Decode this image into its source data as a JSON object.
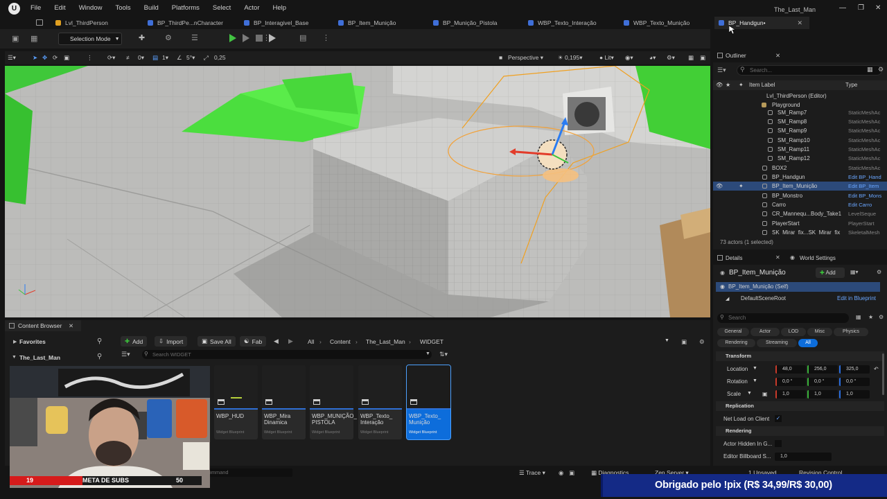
{
  "menu": {
    "items": [
      "File",
      "Edit",
      "Window",
      "Tools",
      "Build",
      "Platforms",
      "Select",
      "Actor",
      "Help"
    ],
    "project_name": "The_Last_Man"
  },
  "tabs": [
    {
      "label": "Lvl_ThirdPerson",
      "active": false
    },
    {
      "label": "BP_ThirdPe...nCharacter",
      "active": false
    },
    {
      "label": "BP_Interagivel_Base",
      "active": false
    },
    {
      "label": "BP_Item_Munição",
      "active": false
    },
    {
      "label": "BP_Munição_Pistola",
      "active": false
    },
    {
      "label": "WBP_Texto_Interação",
      "active": false
    },
    {
      "label": "WBP_Texto_Munição",
      "active": false
    },
    {
      "label": "BP_Handgun•",
      "active": true
    }
  ],
  "toolbar": {
    "selection_mode": "Selection Mode"
  },
  "viewport": {
    "grid_value": "0",
    "rot_value": "1",
    "snap_angle": "5°",
    "scale_snap": "0,25",
    "perspective": "Perspective",
    "speed": "0,195",
    "lit": "Lit"
  },
  "outliner": {
    "title": "Outliner",
    "search_placeholder": "Search...",
    "col_label": "Item Label",
    "col_type": "Type",
    "rows": [
      {
        "label": "Lvl_ThirdPerson (Editor)",
        "type": ""
      },
      {
        "label": "Playground",
        "type": ""
      },
      {
        "label": "SM_Ramp7",
        "type": "StaticMeshAc"
      },
      {
        "label": "SM_Ramp8",
        "type": "StaticMeshAc"
      },
      {
        "label": "SM_Ramp9",
        "type": "StaticMeshAc"
      },
      {
        "label": "SM_Ramp10",
        "type": "StaticMeshAc"
      },
      {
        "label": "SM_Ramp11",
        "type": "StaticMeshAc"
      },
      {
        "label": "SM_Ramp12",
        "type": "StaticMeshAc"
      },
      {
        "label": "BOX2",
        "type": "StaticMeshAc"
      },
      {
        "label": "BP_Handgun",
        "type": "Edit BP_Hand"
      },
      {
        "label": "BP_Item_Munição",
        "type": "Edit BP_Item"
      },
      {
        "label": "BP_Monstro",
        "type": "Edit BP_Mons"
      },
      {
        "label": "Carro",
        "type": "Edit Carro"
      },
      {
        "label": "CR_Mannequ...Body_Take1",
        "type": "LevelSeque"
      },
      {
        "label": "PlayerStart",
        "type": "PlayerStart"
      },
      {
        "label": "SK_Mirar_fix...SK_Mirar_fix",
        "type": "SkeletalMesh"
      }
    ],
    "footer": "73 actors (1 selected)"
  },
  "details": {
    "title": "Details",
    "world_settings": "World Settings",
    "actor_name": "BP_Item_Munição",
    "add_label": "Add",
    "self_label": "BP_Item_Munição (Self)",
    "root_label": "DefaultSceneRoot",
    "edit_in_blueprint": "Edit in Blueprint",
    "search_placeholder": "Search",
    "filters_row1": [
      "General",
      "Actor",
      "LOD",
      "Misc",
      "Physics"
    ],
    "filters_row2": [
      "Rendering",
      "Streaming",
      "All"
    ],
    "transform_title": "Transform",
    "location_label": "Location",
    "location": [
      "48,0",
      "256,0",
      "325,0"
    ],
    "rotation_label": "Rotation",
    "rotation": [
      "0,0 °",
      "0,0 °",
      "0,0 °"
    ],
    "scale_label": "Scale",
    "scale": [
      "1,0",
      "1,0",
      "1,0"
    ],
    "replication_title": "Replication",
    "net_load_label": "Net Load on Client",
    "rendering_title": "Rendering",
    "actor_hidden_label": "Actor Hidden In G...",
    "billboard_label": "Editor Billboard S...",
    "billboard_value": "1,0"
  },
  "content_browser": {
    "tab": "Content Browser",
    "add": "Add",
    "import": "Import",
    "save_all": "Save All",
    "fab": "Fab",
    "favorites": "Favorites",
    "root_folder": "The_Last_Man",
    "crumbs": [
      "All",
      "Content",
      "The_Last_Man",
      "WIDGET"
    ],
    "search_placeholder": "Search WIDGET",
    "assets": [
      {
        "name": "WBP_HUD",
        "kind": "Widget Blueprint",
        "selected": false
      },
      {
        "name": "WBP_Mira Dinamica",
        "kind": "Widget Blueprint",
        "selected": false
      },
      {
        "name": "WBP_MUNIÇÃO_ PISTOLA",
        "kind": "Widget Blueprint",
        "selected": false
      },
      {
        "name": "WBP_Texto_ Interação",
        "kind": "Widget Blueprint",
        "selected": false
      },
      {
        "name": "WBP_Texto_ Munição",
        "kind": "Widget Blueprint",
        "selected": true
      }
    ]
  },
  "status": {
    "command_placeholder": "Command",
    "trace": "Trace",
    "derived_data": "Diagnostics",
    "zen": "Zen Server",
    "unsaved": "1 Unsaved",
    "revision": "Revision Control"
  },
  "overlay": {
    "subs_title": "META DE SUBS",
    "subs_current": "19",
    "subs_goal": "50",
    "subs_fraction": 0.38,
    "banner": "Obrigado pelo !pix (R$ 34,99/R$ 30,00)"
  },
  "colors": {
    "accent": "#0d6ddb",
    "green_mesh": "#4cdf3a",
    "selection": "#2c4a7a",
    "banner": "#142a86"
  }
}
